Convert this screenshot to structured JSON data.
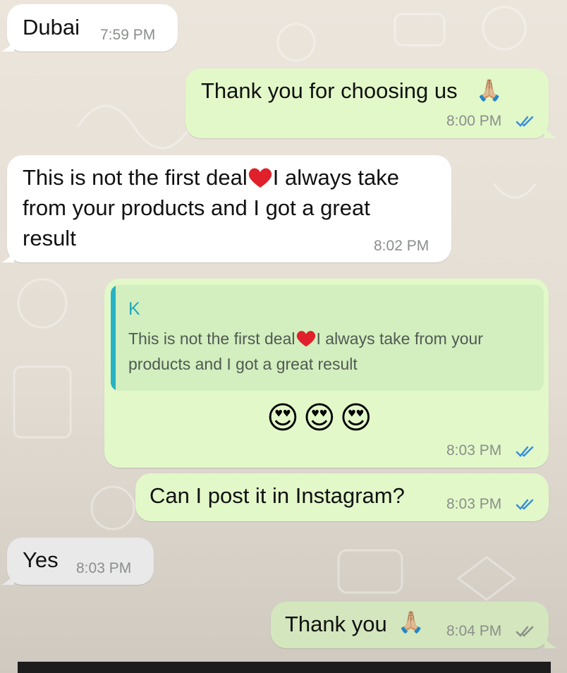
{
  "messages": [
    {
      "id": "m1",
      "direction": "incoming",
      "text": "Dubai",
      "time": "7:59 PM"
    },
    {
      "id": "m2",
      "direction": "outgoing",
      "text": "Thank you for choosing us",
      "emoji": "🙏🏼",
      "time": "8:00 PM",
      "status": "read"
    },
    {
      "id": "m3",
      "direction": "incoming",
      "text_line1a": "This is not the first deal",
      "text_line1b": "I always take",
      "text_line2": "from your products and I got a great",
      "text_line3": "result",
      "time": "8:02 PM"
    },
    {
      "id": "m4",
      "direction": "outgoing",
      "quoted_author": "K",
      "quoted_text_a": "This is not the first deal",
      "quoted_text_b": "I always take from your products and I got a great result",
      "emojis": "😍😍😍",
      "time": "8:03 PM",
      "status": "read"
    },
    {
      "id": "m5",
      "direction": "outgoing",
      "text": "Can I post it in Instagram?",
      "time": "8:03 PM",
      "status": "read"
    },
    {
      "id": "m6",
      "direction": "incoming",
      "text": "Yes",
      "time": "8:03 PM"
    },
    {
      "id": "m7",
      "direction": "outgoing",
      "text": "Thank you",
      "emoji": "🙏🏼",
      "time": "8:04 PM",
      "status": "read"
    }
  ],
  "colors": {
    "incoming_bubble": "#ffffff",
    "outgoing_bubble": "#e2f8c9",
    "read_ticks": "#3b8fd6",
    "quote_bar": "#26b3c6"
  },
  "icons": {
    "read_receipt": "double-check-icon",
    "heart": "red-heart-icon"
  }
}
